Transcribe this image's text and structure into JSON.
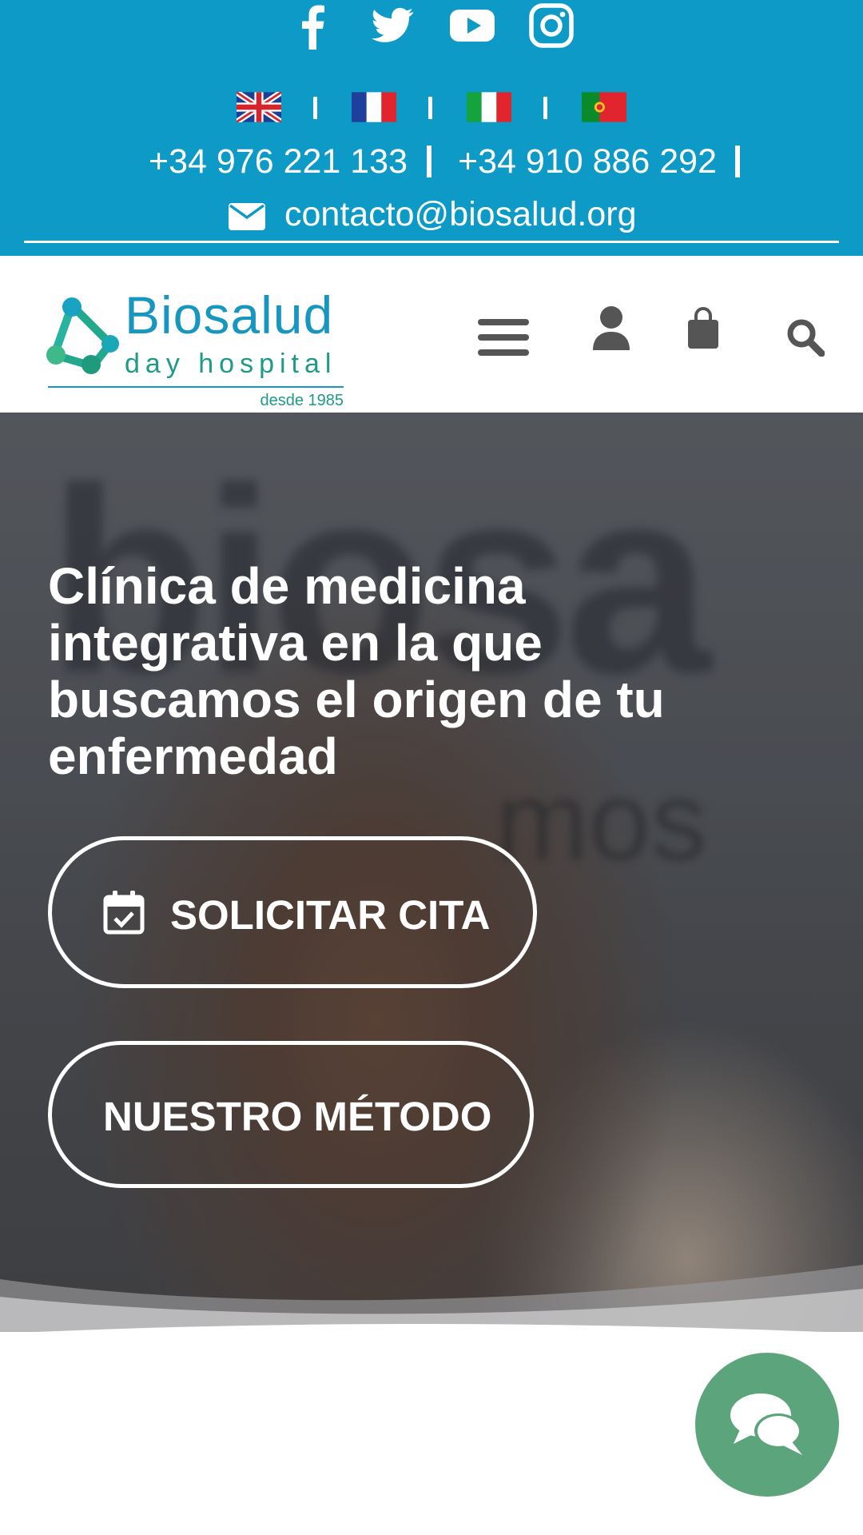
{
  "colors": {
    "topbar_bg": "#0d9ac6",
    "brand_blue": "#1797c0",
    "brand_green": "#1f9a86",
    "chat_bg": "#5ba47c"
  },
  "social": {
    "icons": [
      "facebook-icon",
      "twitter-icon",
      "youtube-icon",
      "instagram-icon"
    ]
  },
  "languages": [
    {
      "name": "English",
      "flag": "uk-flag-icon"
    },
    {
      "name": "Français",
      "flag": "france-flag-icon"
    },
    {
      "name": "Italiano",
      "flag": "italy-flag-icon"
    },
    {
      "name": "Português",
      "flag": "portugal-flag-icon"
    }
  ],
  "contact": {
    "phone_1": "+34 976 221 133",
    "phone_2": "+34 910 886 292",
    "email": "contacto@biosalud.org"
  },
  "logo": {
    "brand": "Biosalud",
    "subtitle": "day hospital",
    "since": "desde 1985"
  },
  "header_icons": [
    "menu-icon",
    "user-icon",
    "cart-icon",
    "search-icon"
  ],
  "hero": {
    "title": "Clínica de medicina integrativa en la que buscamos el origen de tu enfermedad",
    "primary_button": "SOLICITAR CITA",
    "secondary_button": "NUESTRO MÉTODO"
  },
  "chat": {
    "icon": "chat-icon"
  }
}
